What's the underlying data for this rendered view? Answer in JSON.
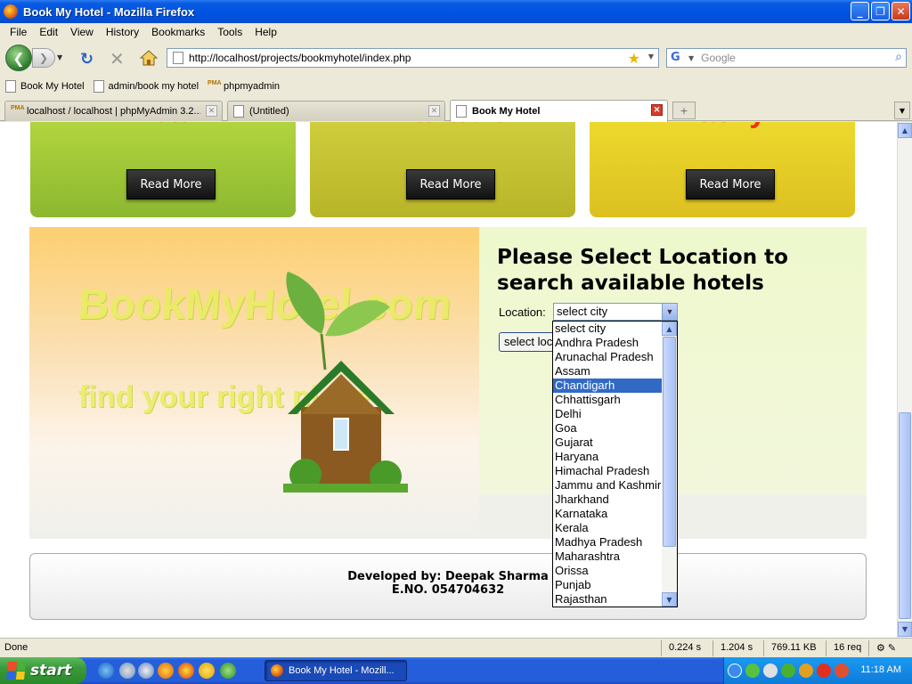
{
  "window": {
    "title": "Book My Hotel - Mozilla Firefox",
    "min": "_",
    "max": "❐",
    "close": "✕"
  },
  "menu": [
    "File",
    "Edit",
    "View",
    "History",
    "Bookmarks",
    "Tools",
    "Help"
  ],
  "nav": {
    "url": "http://localhost/projects/bookmyhotel/index.php",
    "search_placeholder": "Google"
  },
  "bookmarks": [
    "Book My Hotel",
    "admin/book my hotel",
    "phpmyadmin"
  ],
  "tabs": [
    {
      "label": "localhost / localhost | phpMyAdmin 3.2....",
      "active": false
    },
    {
      "label": "(Untitled)",
      "active": false
    },
    {
      "label": "Book My Hotel",
      "active": true
    }
  ],
  "cards": [
    {
      "button": "Read More",
      "color": "#9cc640"
    },
    {
      "button": "Read More",
      "color": "#c4c42a"
    },
    {
      "button": "Read More",
      "color": "#e8d41a"
    }
  ],
  "banner": {
    "logo_text": "BookMyHotel.com",
    "tagline": "find your right place"
  },
  "search": {
    "heading": "Please Select Location to search available hotels",
    "location_label": "Location:",
    "selected": "select city",
    "button_label": "select location"
  },
  "dropdown": {
    "options": [
      "select city",
      "Andhra Pradesh",
      "Arunachal Pradesh",
      "Assam",
      "Chandigarh",
      "Chhattisgarh",
      "Delhi",
      "Goa",
      "Gujarat",
      "Haryana",
      "Himachal Pradesh",
      "Jammu and Kashmir",
      "Jharkhand",
      "Karnataka",
      "Kerala",
      "Madhya Pradesh",
      "Maharashtra",
      "Orissa",
      "Punjab",
      "Rajasthan"
    ],
    "highlighted": "Chandigarh"
  },
  "footer": {
    "line1": "Developed by: Deepak Sharma",
    "line2": "E.NO. 054704632"
  },
  "status": {
    "text": "Done",
    "time1": "0.224 s",
    "time2": "1.204 s",
    "size": "769.11 KB",
    "requests": "16 req"
  },
  "taskbar": {
    "start": "start",
    "task": "Book My Hotel - Mozill...",
    "clock": "11:18 AM"
  }
}
